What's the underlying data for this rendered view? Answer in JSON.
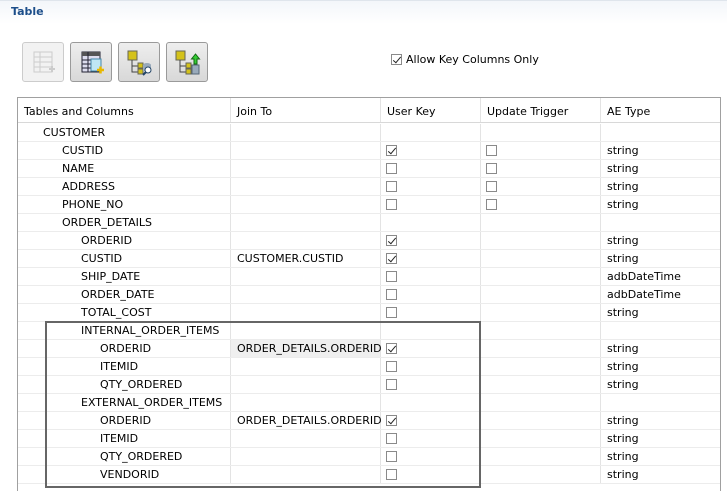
{
  "section_title": "Table",
  "toolbar": [
    {
      "name": "add-table-button",
      "icon": "table-add-icon",
      "enabled": false
    },
    {
      "name": "add-table-columns-button",
      "icon": "table-columns-add-icon",
      "enabled": true
    },
    {
      "name": "browse-schema-button",
      "icon": "tree-db-search-icon",
      "enabled": true
    },
    {
      "name": "import-schema-button",
      "icon": "tree-db-upload-icon",
      "enabled": true
    }
  ],
  "allow_key_columns": {
    "label": "Allow Key Columns Only",
    "checked": true
  },
  "columns": [
    "Tables and Columns",
    "Join To",
    "User Key",
    "Update Trigger",
    "AE Type"
  ],
  "rows": [
    {
      "name": "CUSTOMER",
      "level": 0,
      "join": "",
      "key": null,
      "trigger": null,
      "type": ""
    },
    {
      "name": "CUSTID",
      "level": 1,
      "join": "",
      "key": true,
      "trigger": false,
      "type": "string"
    },
    {
      "name": "NAME",
      "level": 1,
      "join": "",
      "key": false,
      "trigger": false,
      "type": "string"
    },
    {
      "name": "ADDRESS",
      "level": 1,
      "join": "",
      "key": false,
      "trigger": false,
      "type": "string"
    },
    {
      "name": "PHONE_NO",
      "level": 1,
      "join": "",
      "key": false,
      "trigger": false,
      "type": "string"
    },
    {
      "name": "ORDER_DETAILS",
      "level": 1,
      "join": "",
      "key": null,
      "trigger": null,
      "type": ""
    },
    {
      "name": "ORDERID",
      "level": 2,
      "join": "",
      "key": true,
      "trigger": null,
      "type": "string"
    },
    {
      "name": "CUSTID",
      "level": 2,
      "join": "CUSTOMER.CUSTID",
      "key": true,
      "trigger": null,
      "type": "string"
    },
    {
      "name": "SHIP_DATE",
      "level": 2,
      "join": "",
      "key": false,
      "trigger": null,
      "type": "adbDateTime"
    },
    {
      "name": "ORDER_DATE",
      "level": 2,
      "join": "",
      "key": false,
      "trigger": null,
      "type": "adbDateTime"
    },
    {
      "name": "TOTAL_COST",
      "level": 2,
      "join": "",
      "key": false,
      "trigger": null,
      "type": "string"
    },
    {
      "name": "INTERNAL_ORDER_ITEMS",
      "level": 2,
      "join": "",
      "key": null,
      "trigger": null,
      "type": ""
    },
    {
      "name": "ORDERID",
      "level": 3,
      "join": "ORDER_DETAILS.ORDERID",
      "key": true,
      "trigger": null,
      "type": "string",
      "shade": true
    },
    {
      "name": "ITEMID",
      "level": 3,
      "join": "",
      "key": false,
      "trigger": null,
      "type": "string"
    },
    {
      "name": "QTY_ORDERED",
      "level": 3,
      "join": "",
      "key": false,
      "trigger": null,
      "type": "string"
    },
    {
      "name": "EXTERNAL_ORDER_ITEMS",
      "level": 2,
      "join": "",
      "key": null,
      "trigger": null,
      "type": ""
    },
    {
      "name": "ORDERID",
      "level": 3,
      "join": "ORDER_DETAILS.ORDERID",
      "key": true,
      "trigger": null,
      "type": "string"
    },
    {
      "name": "ITEMID",
      "level": 3,
      "join": "",
      "key": false,
      "trigger": null,
      "type": "string"
    },
    {
      "name": "QTY_ORDERED",
      "level": 3,
      "join": "",
      "key": false,
      "trigger": null,
      "type": "string"
    },
    {
      "name": "VENDORID",
      "level": 3,
      "join": "",
      "key": false,
      "trigger": null,
      "type": "string"
    }
  ]
}
